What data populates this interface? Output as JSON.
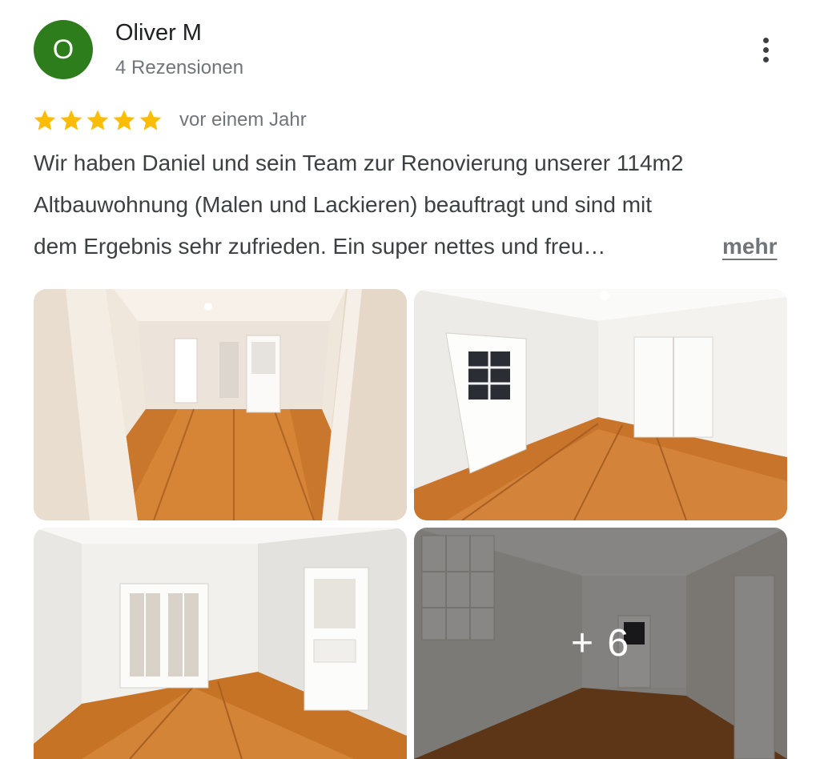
{
  "reviewer": {
    "initial": "O",
    "name": "Oliver M",
    "review_count": "4 Rezensionen",
    "avatar_color": "#2e7d1c"
  },
  "review": {
    "rating": 5,
    "max_rating": 5,
    "star_color": "#fbbc04",
    "date": "vor einem Jahr",
    "text_lines": [
      "Wir haben Daniel und sein Team zur Renovierung unserer 114m2",
      "Altbauwohnung (Malen und Lackieren) beauftragt und sind mit",
      "dem Ergebnis sehr zufrieden. Ein super nettes und freu…"
    ],
    "more_label": "mehr"
  },
  "photos": {
    "more_overlay": "+ 6"
  },
  "icons": {
    "menu": "more-vert-icon",
    "star": "star-icon"
  }
}
